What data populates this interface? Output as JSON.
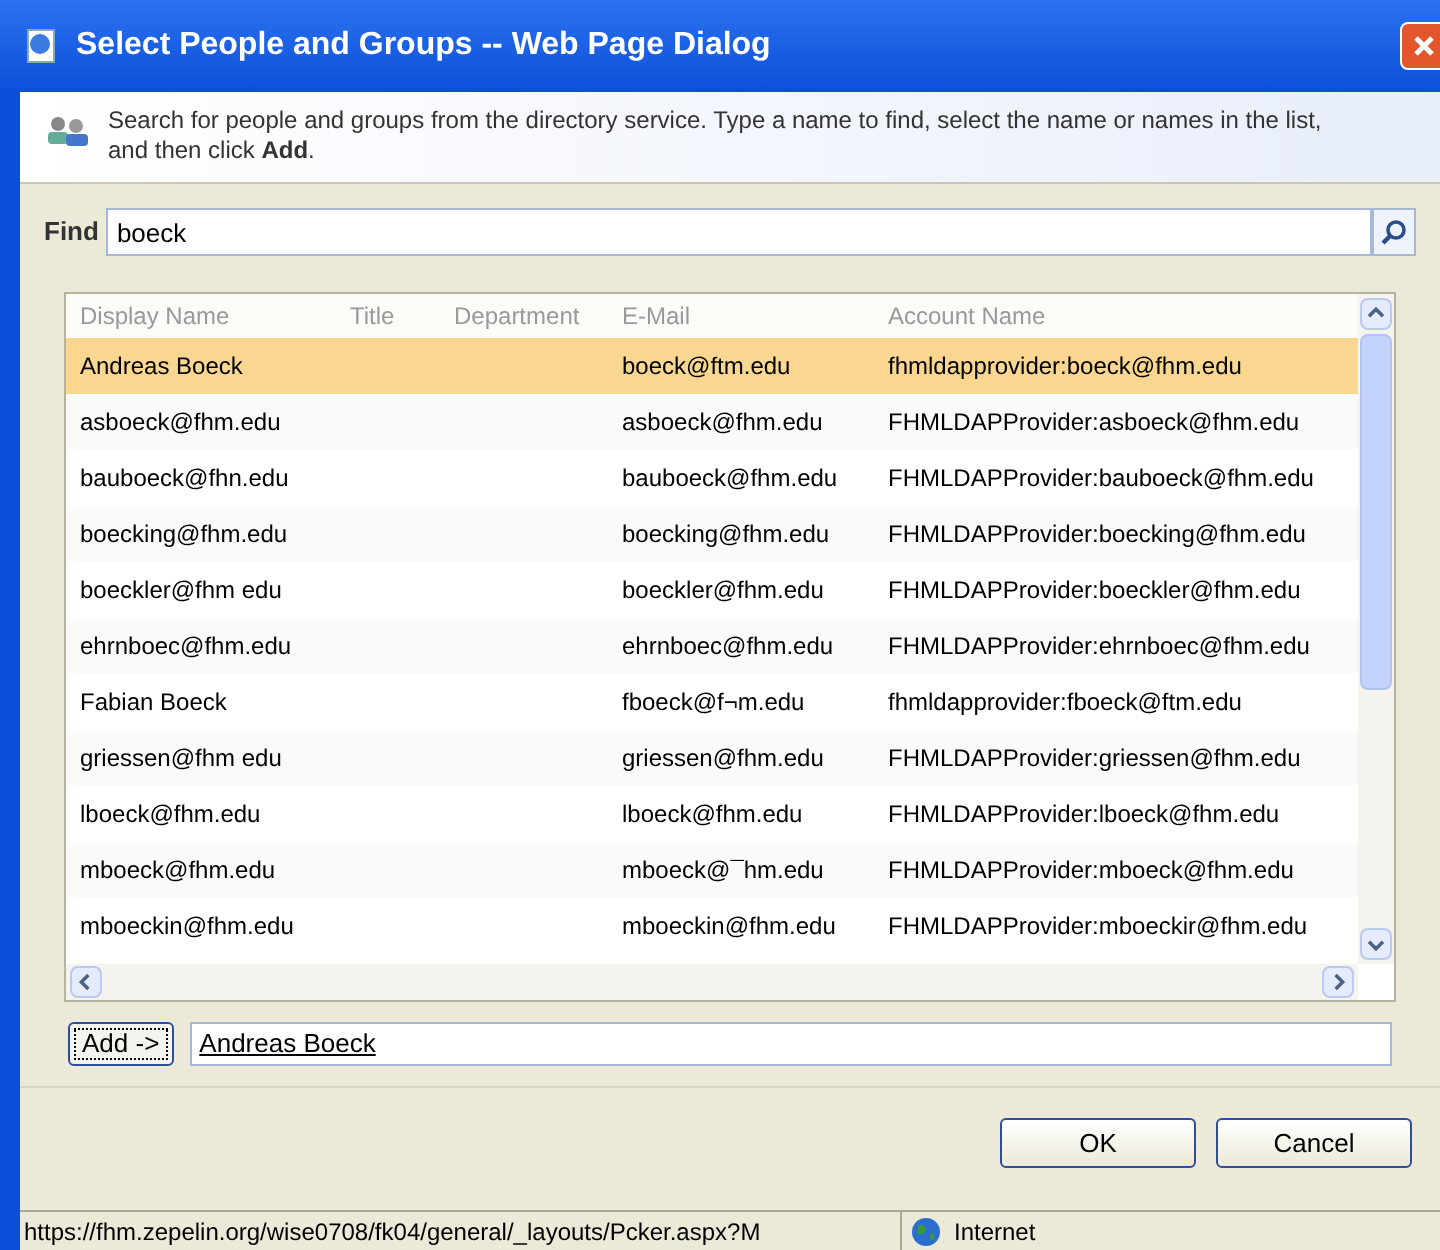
{
  "window": {
    "title": "Select People and Groups -- Web Page Dialog"
  },
  "intro": "Search for people and groups from the directory service. Type a name to find, select the name or names in the list, and then click **Add**.",
  "find": {
    "label": "Find",
    "value": "boeck"
  },
  "table": {
    "columns": [
      "Display Name",
      "Title",
      "Department",
      "E-Mail",
      "Account Name"
    ],
    "rows": [
      {
        "display_name": "Andreas Boeck",
        "email": "boeck@ftm.edu",
        "account": "fhmldapprovider:boeck@fhm.edu",
        "selected": true
      },
      {
        "display_name": "asboeck@fhm.edu",
        "email": "asboeck@fhm.edu",
        "account": "FHMLDAPProvider:asboeck@fhm.edu",
        "selected": false
      },
      {
        "display_name": "bauboeck@fhn.edu",
        "email": "bauboeck@fhm.edu",
        "account": "FHMLDAPProvider:bauboeck@fhm.edu",
        "selected": false
      },
      {
        "display_name": "boecking@fhm.edu",
        "email": "boecking@fhm.edu",
        "account": "FHMLDAPProvider:boecking@fhm.edu",
        "selected": false
      },
      {
        "display_name": "boeckler@fhm edu",
        "email": "boeckler@fhm.edu",
        "account": "FHMLDAPProvider:boeckler@fhm.edu",
        "selected": false
      },
      {
        "display_name": "ehrnboec@fhm.edu",
        "email": "ehrnboec@fhm.edu",
        "account": "FHMLDAPProvider:ehrnboec@fhm.edu",
        "selected": false
      },
      {
        "display_name": "Fabian Boeck",
        "email": "fboeck@f¬m.edu",
        "account": "fhmldapprovider:fboeck@ftm.edu",
        "selected": false
      },
      {
        "display_name": "griessen@fhm edu",
        "email": "griessen@fhm.edu",
        "account": "FHMLDAPProvider:griessen@fhm.edu",
        "selected": false
      },
      {
        "display_name": "lboeck@fhm.edu",
        "email": "lboeck@fhm.edu",
        "account": "FHMLDAPProvider:lboeck@fhm.edu",
        "selected": false
      },
      {
        "display_name": "mboeck@fhm.edu",
        "email": "mboeck@¯hm.edu",
        "account": "FHMLDAPProvider:mboeck@fhm.edu",
        "selected": false
      },
      {
        "display_name": "mboeckin@fhm.edu",
        "email": "mboeckin@fhm.edu",
        "account": "FHMLDAPProvider:mboeckir@fhm.edu",
        "selected": false
      }
    ]
  },
  "add": {
    "button": "Add ->",
    "value": "Andreas Boeck"
  },
  "buttons": [
    "OK",
    "Cancel"
  ],
  "status_bar": {
    "url": "https://fhm.zepelin.org/wise0708/fk04/general/_layouts/Pcker.aspx?M",
    "zone": "Internet"
  }
}
